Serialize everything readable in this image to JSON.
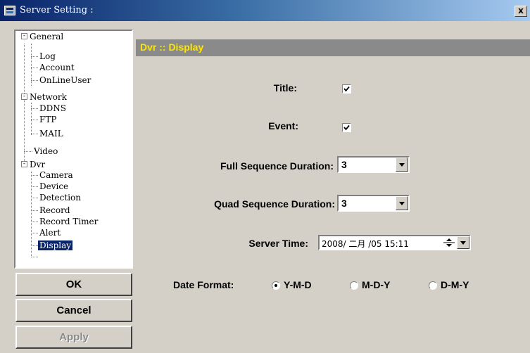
{
  "window": {
    "title": "Server Setting :",
    "close_label": "x"
  },
  "tree": {
    "general": "General",
    "log": "Log",
    "account": "Account",
    "onlineuser": "OnLineUser",
    "network": "Network",
    "ddns": "DDNS",
    "ftp": "FTP",
    "mail": "MAIL",
    "video": "Video",
    "dvr": "Dvr",
    "camera": "Camera",
    "device": "Device",
    "detection": "Detection",
    "record": "Record",
    "record_timer": "Record Timer",
    "alert": "Alert",
    "display": "Display",
    "selected": "Display"
  },
  "buttons": {
    "ok": "OK",
    "cancel": "Cancel",
    "apply": "Apply"
  },
  "panel": {
    "title": "Dvr :: Display"
  },
  "form": {
    "title_label": "Title:",
    "title_checked": true,
    "event_label": "Event:",
    "event_checked": true,
    "full_seq_label": "Full Sequence Duration:",
    "full_seq_value": "3",
    "quad_seq_label": "Quad Sequence Duration:",
    "quad_seq_value": "3",
    "server_time_label": "Server Time:",
    "server_time_value": "2008/ 二月 /05 15:11",
    "date_format_label": "Date Format:",
    "date_format_options": [
      "Y-M-D",
      "M-D-Y",
      "D-M-Y"
    ],
    "date_format_selected": "Y-M-D"
  },
  "colors": {
    "dialog_bg": "#d4d0c8",
    "panel_header_bg": "#8a8a8a",
    "panel_title_color": "#ffe600",
    "selection_bg": "#0a246a"
  }
}
